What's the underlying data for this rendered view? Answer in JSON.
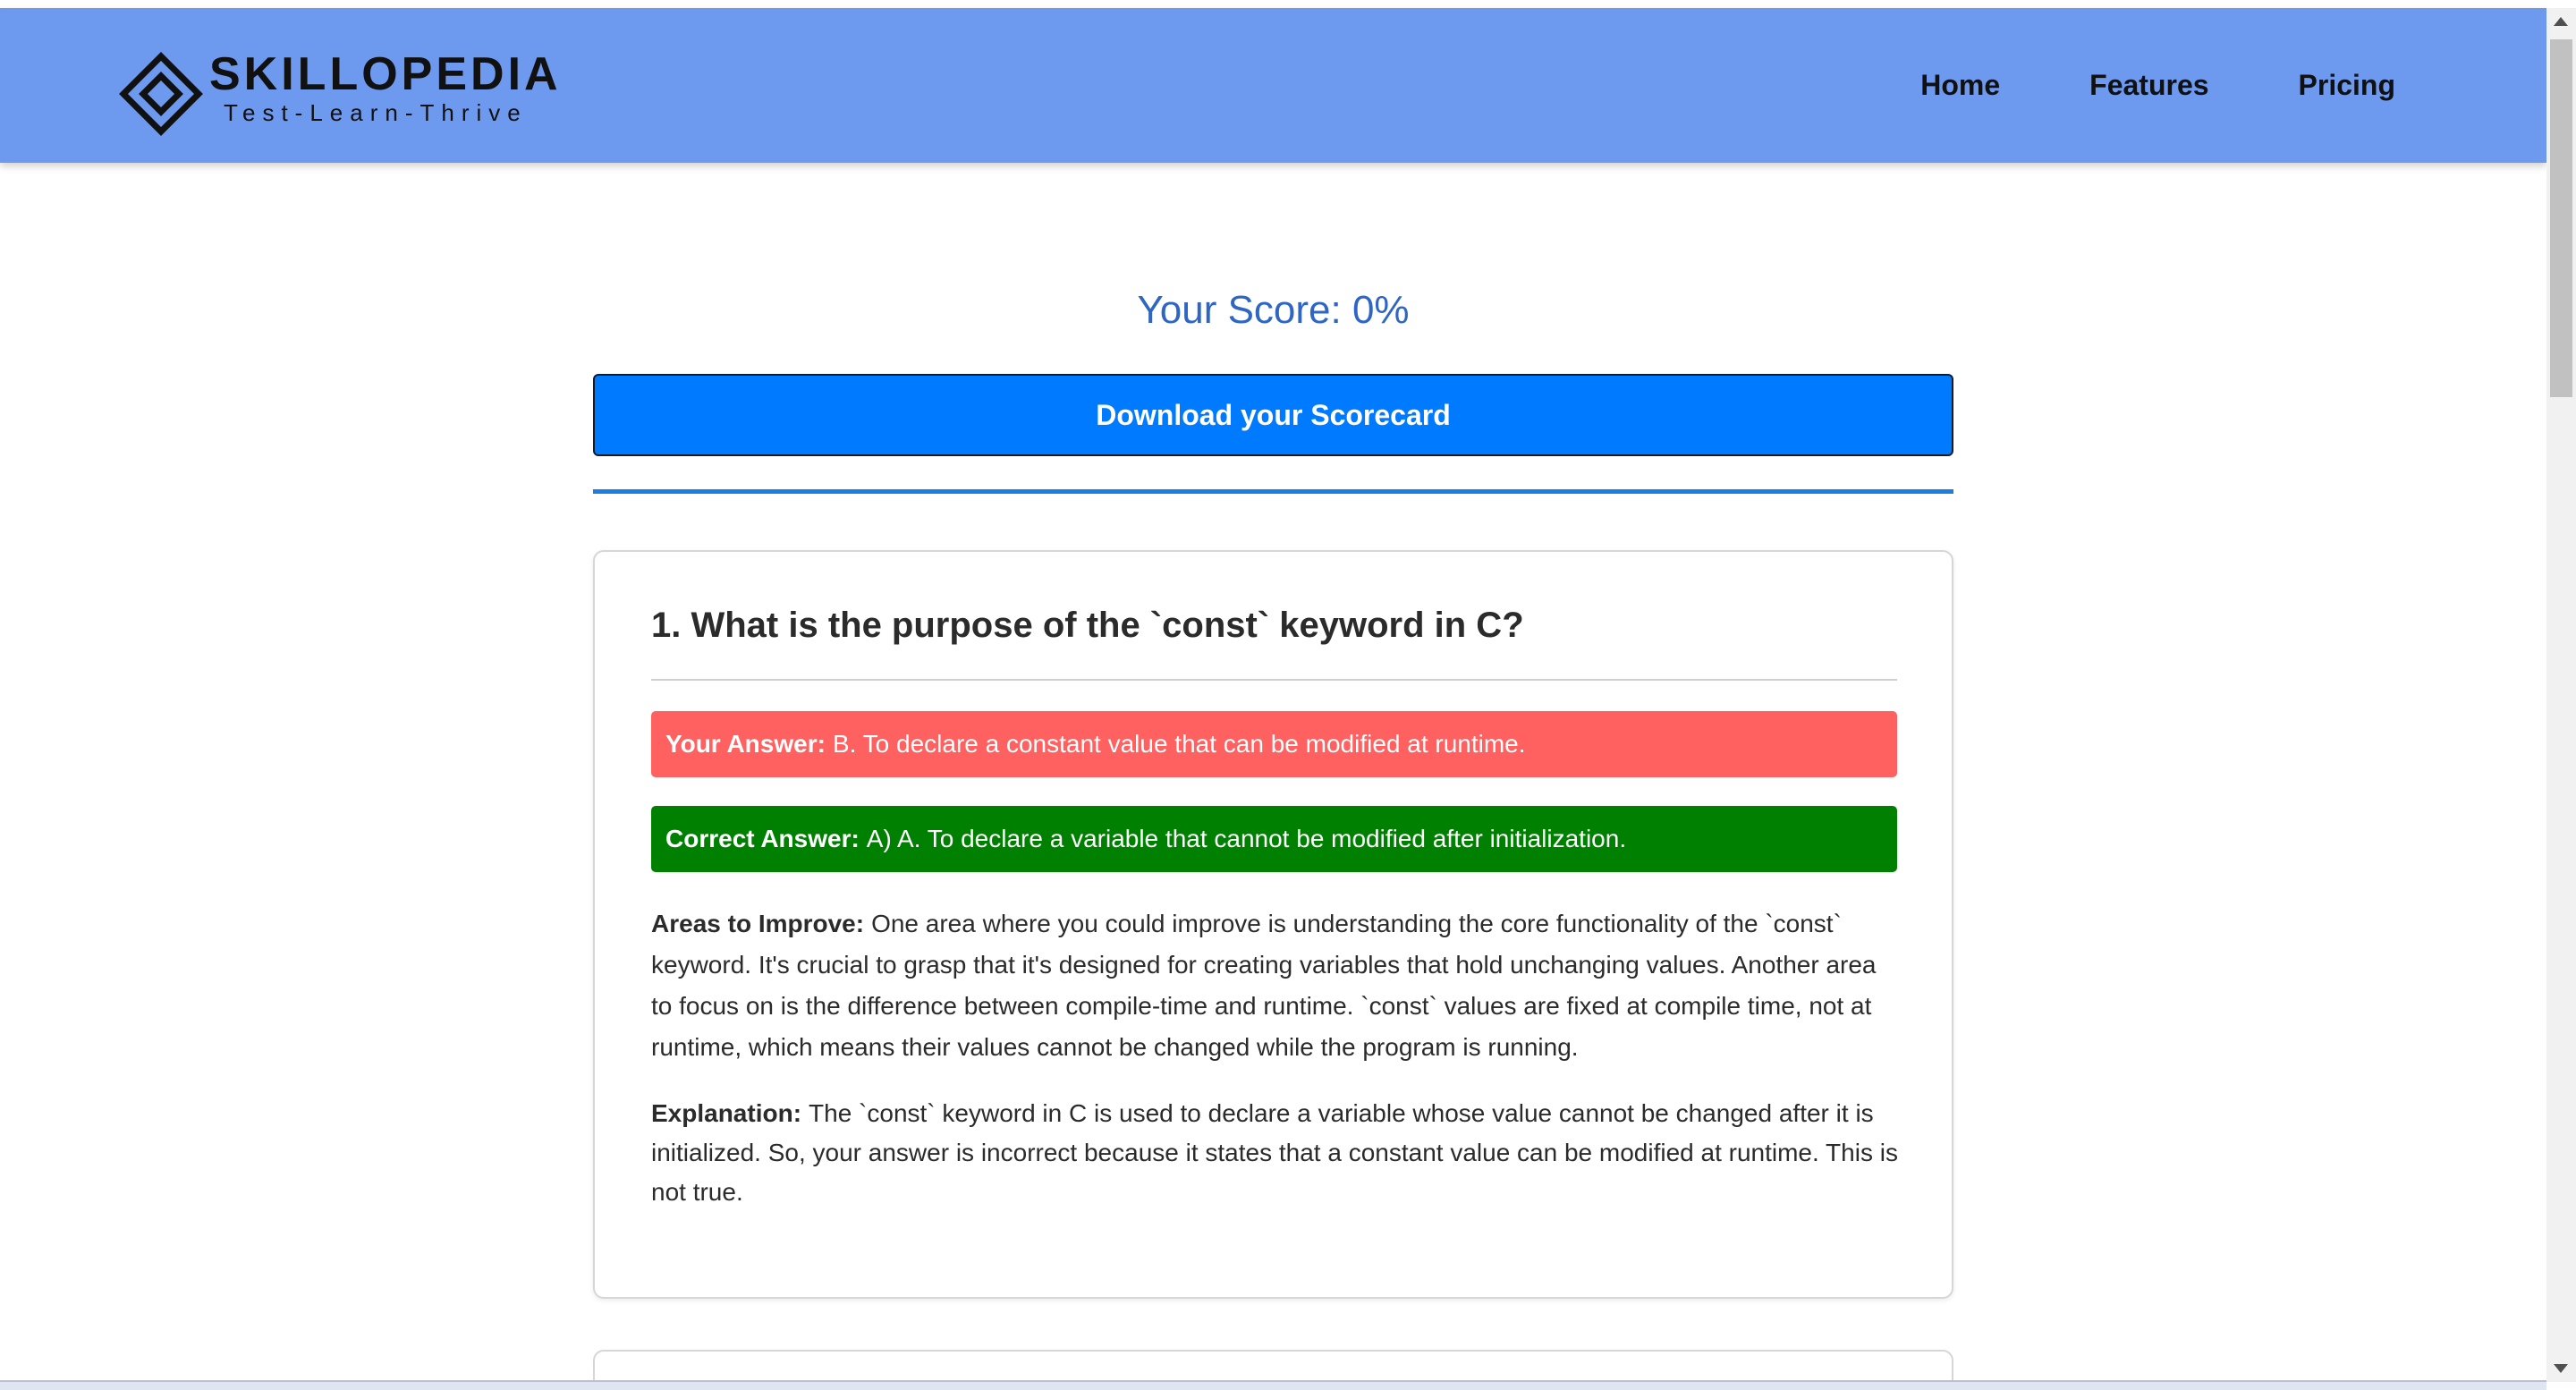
{
  "brand": {
    "name": "SKILLOPEDIA",
    "tagline": "Test-Learn-Thrive"
  },
  "nav": {
    "links": [
      "Home",
      "Features",
      "Pricing"
    ]
  },
  "results": {
    "score_text": "Your Score: 0%",
    "score_percent": 0,
    "download_label": "Download your Scorecard"
  },
  "question": {
    "title": "1. What is the purpose of the `const` keyword in C?",
    "your_answer_label": "Your Answer:",
    "your_answer": "B. To declare a constant value that can be modified at runtime.",
    "correct_answer_label": "Correct Answer:",
    "correct_answer": "A) A. To declare a variable that cannot be modified after initialization.",
    "improve_label": "Areas to Improve:",
    "improve_text": "One area where you could improve is understanding the core functionality of the `const` keyword. It's crucial to grasp that it's designed for creating variables that hold unchanging values. Another area to focus on is the difference between compile-time and runtime. `const` values are fixed at compile time, not at runtime, which means their values cannot be changed while the program is running.",
    "explanation_label": "Explanation:",
    "explanation_text": "The `const` keyword in C is used to declare a variable whose value cannot be changed after it is initialized. So, your answer is incorrect because it states that a constant value can be modified at runtime. This is not true."
  },
  "colors": {
    "navbar": "#6d99ef",
    "score_text": "#2f66c4",
    "download_button": "#007bff",
    "wrong_answer": "#ff6060",
    "correct_answer": "#008000"
  },
  "icons": {
    "logo": "diamond-logo-icon"
  }
}
